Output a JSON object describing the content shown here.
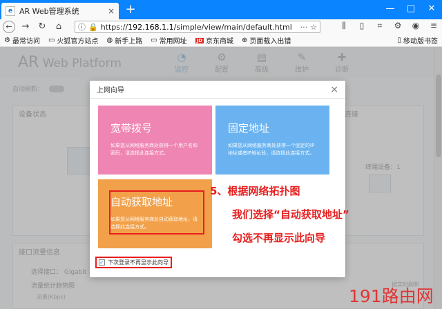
{
  "browser": {
    "tab_title": "AR Web管理系统",
    "tab_close": "×",
    "new_tab": "+",
    "win_minimize": "—",
    "win_maximize": "□",
    "win_close": "✕",
    "url_prefix": "https://",
    "url_domain": "192.168.1.1",
    "url_path": "/simple/view/main/default.html",
    "more": "···"
  },
  "bookmarks": [
    {
      "label": "最常访问"
    },
    {
      "label": "火狐官方站点"
    },
    {
      "label": "新手上路"
    },
    {
      "label": "常用网址"
    },
    {
      "label": "京东商城",
      "badge": "JD"
    },
    {
      "label": "页面载入出错"
    }
  ],
  "bookmarks_right": "移动版书签",
  "app": {
    "logo_ar": "AR",
    "logo_rest": " Web Platform",
    "nav": [
      {
        "label": "监控",
        "icon": "◔"
      },
      {
        "label": "配置",
        "icon": "⚙"
      },
      {
        "label": "高级",
        "icon": "▤"
      },
      {
        "label": "维护",
        "icon": "✎"
      },
      {
        "label": "诊断",
        "icon": "✚"
      }
    ],
    "auto_refresh": "自动刷新：",
    "user_prefix": "用户",
    "device_status": "设备状态",
    "connect": "连接",
    "terminal": "终端设备：1",
    "iface_traffic": "接口流量信息",
    "select_iface": "选择接口：",
    "iface_value": "Gigabit",
    "traffic_chart": "流量统计趋势图",
    "traffic_unit": "流量(Kbps)",
    "realtime": "按实时刷新"
  },
  "modal": {
    "title": "上网向导",
    "close": "×",
    "cards": [
      {
        "title": "宽带拨号",
        "desc": "如果您从网络服务商处获得一个用户名和密码，请选择此连接方式。"
      },
      {
        "title": "固定地址",
        "desc": "如果您从网络服务商处获得一个固定的IP地址或者IP地址段，请选择此连接方式。"
      },
      {
        "title": "自动获取地址",
        "desc": "如果您从网络服务商处自动获取地址，请选择此连接方式。"
      }
    ],
    "checkbox_label": "下次登录不再显示此向导",
    "checkbox_mark": "✓"
  },
  "annotations": {
    "line1": "5、根据网络拓扑图",
    "line2": "我们选择“自动获取地址”",
    "line3": "勾选不再显示此向导"
  },
  "watermark": "191路由网"
}
